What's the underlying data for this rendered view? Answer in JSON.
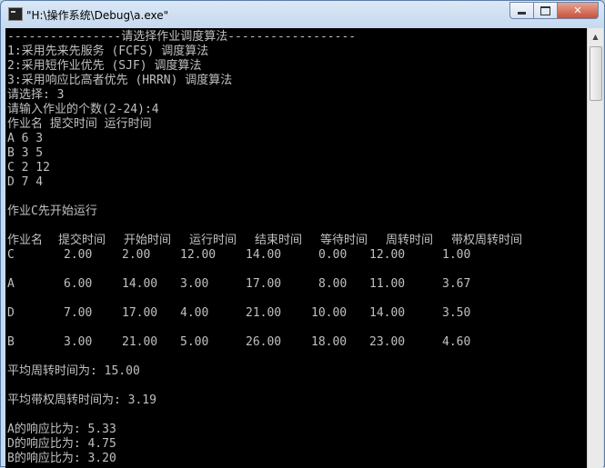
{
  "window": {
    "title": "\"H:\\操作系统\\Debug\\a.exe\"",
    "min_icon": "minimize-icon",
    "max_icon": "maximize-icon",
    "close_icon": "close-icon",
    "close_glyph": "✕"
  },
  "console": {
    "menu": {
      "header": "----------------请选择作业调度算法------------------",
      "option1": "1:采用先来先服务 (FCFS) 调度算法",
      "option2": "2:采用短作业优先 (SJF) 调度算法",
      "option3": "3:采用响应比高者优先 (HRRN) 调度算法",
      "choice_prompt": "请选择: 3",
      "count_prompt": "请输入作业的个数(2-24):4"
    },
    "input_header": "作业名 提交时间 运行时间",
    "inputs": [
      "A 6 3",
      "B 3 5",
      "C 2 12",
      "D 7 4"
    ],
    "first_run": "作业C先开始运行",
    "table": {
      "headers": [
        "作业名",
        "提交时间",
        "开始时间",
        "运行时间",
        "结束时间",
        "等待时间",
        "周转时间",
        "带权周转时间"
      ],
      "rows": [
        [
          "C",
          "2.00",
          "2.00",
          "12.00",
          "14.00",
          "0.00",
          "12.00",
          "1.00"
        ],
        [
          "A",
          "6.00",
          "14.00",
          "3.00",
          "17.00",
          "8.00",
          "11.00",
          "3.67"
        ],
        [
          "D",
          "7.00",
          "17.00",
          "4.00",
          "21.00",
          "10.00",
          "14.00",
          "3.50"
        ],
        [
          "B",
          "3.00",
          "21.00",
          "5.00",
          "26.00",
          "18.00",
          "23.00",
          "4.60"
        ]
      ]
    },
    "avg_turnaround": "平均周转时间为: 15.00",
    "avg_weighted": "平均带权周转时间为: 3.19",
    "ratios": [
      "A的响应比为: 5.33",
      "D的响应比为: 4.75",
      "B的响应比为: 3.20"
    ]
  },
  "scrollbar": {
    "up_glyph": "▲",
    "down_glyph": "▼"
  }
}
